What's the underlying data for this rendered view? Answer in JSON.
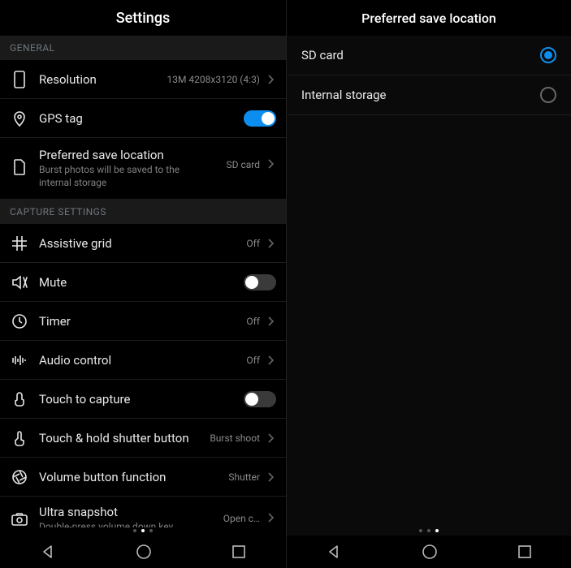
{
  "left": {
    "title": "Settings",
    "sections": {
      "general_header": "GENERAL",
      "capture_header": "CAPTURE SETTINGS"
    },
    "resolution": {
      "label": "Resolution",
      "value": "13M 4208x3120 (4:3)"
    },
    "gps": {
      "label": "GPS tag",
      "on": true
    },
    "save_loc": {
      "label": "Preferred save location",
      "sub": "Burst photos will be saved to the internal storage",
      "value": "SD card"
    },
    "grid": {
      "label": "Assistive grid",
      "value": "Off"
    },
    "mute": {
      "label": "Mute",
      "on": false
    },
    "timer": {
      "label": "Timer",
      "value": "Off"
    },
    "audio": {
      "label": "Audio control",
      "value": "Off"
    },
    "touch_capture": {
      "label": "Touch to capture",
      "on": false
    },
    "hold_shutter": {
      "label": "Touch & hold shutter button",
      "value": "Burst shoot"
    },
    "volume_fn": {
      "label": "Volume button function",
      "value": "Shutter"
    },
    "ultra": {
      "label": "Ultra snapshot",
      "sub": "Double-press volume down key",
      "value": "Open c…"
    }
  },
  "right": {
    "title": "Preferred save location",
    "options": {
      "sd": "SD card",
      "internal": "Internal storage"
    }
  }
}
